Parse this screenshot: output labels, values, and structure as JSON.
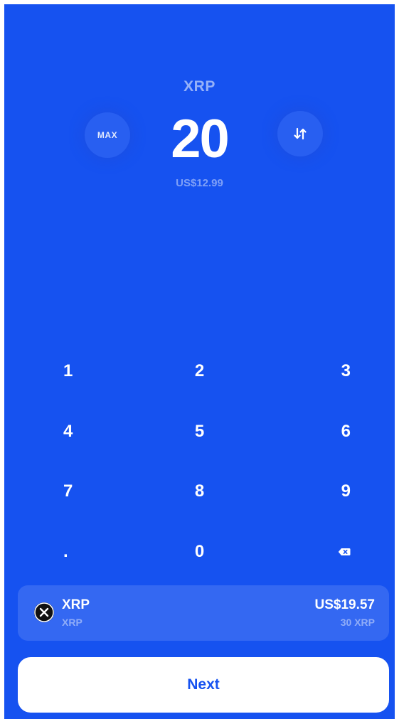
{
  "header": {
    "currency": "XRP",
    "amount": "20",
    "fiat_value": "US$12.99",
    "max_label": "MAX"
  },
  "keypad": {
    "keys": [
      "1",
      "2",
      "3",
      "4",
      "5",
      "6",
      "7",
      "8",
      "9",
      ".",
      "0"
    ]
  },
  "icons": {
    "swap": "swap-arrows-icon",
    "backspace": "backspace-icon",
    "asset": "xrp-logo-icon"
  },
  "asset": {
    "name": "XRP",
    "subtitle": "XRP",
    "fiat_balance": "US$19.57",
    "crypto_balance": "30 XRP"
  },
  "actions": {
    "next_label": "Next"
  },
  "colors": {
    "background": "#1652f0",
    "button": "#ffffff",
    "button_text": "#1652f0"
  }
}
